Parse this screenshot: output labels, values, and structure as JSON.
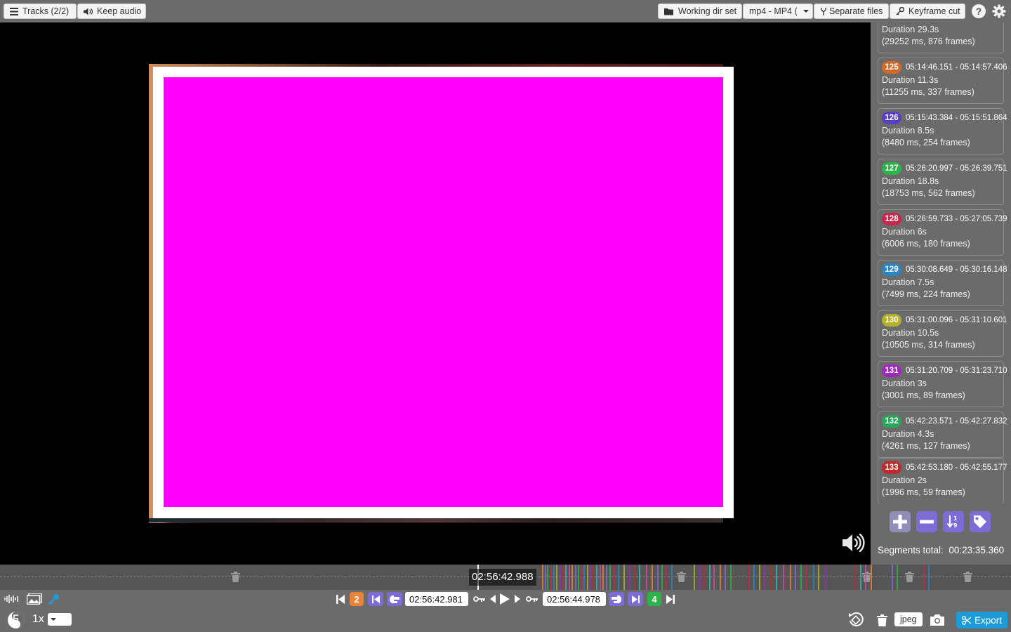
{
  "topbar": {
    "tracks_label": "Tracks (2/2)",
    "keep_audio_label": "Keep audio",
    "working_dir_label": "Working dir set",
    "format_label": "mp4 - MP4 (",
    "separate_files_label": "Separate files",
    "keyframe_cut_label": "Keyframe cut"
  },
  "segments": [
    {
      "num": "",
      "time": "",
      "duration": "Duration 29.3s",
      "detail": "(29252 ms, 876 frames)",
      "color": ""
    },
    {
      "num": "125",
      "time": "05:14:46.151 - 05:14:57.406",
      "duration": "Duration 11.3s",
      "detail": "(11255 ms, 337 frames)",
      "color": "#d06a2a"
    },
    {
      "num": "126",
      "time": "05:15:43.384 - 05:15:51.864",
      "duration": "Duration 8.5s",
      "detail": "(8480 ms, 254 frames)",
      "color": "#5a3fc0"
    },
    {
      "num": "127",
      "time": "05:26:20.997 - 05:26:39.751",
      "duration": "Duration 18.8s",
      "detail": "(18753 ms, 562 frames)",
      "color": "#2db34a"
    },
    {
      "num": "128",
      "time": "05:26:59.733 - 05:27:05.739",
      "duration": "Duration 6s",
      "detail": "(6006 ms, 180 frames)",
      "color": "#c9264b"
    },
    {
      "num": "129",
      "time": "05:30:08.649 - 05:30:16.148",
      "duration": "Duration 7.5s",
      "detail": "(7499 ms, 224 frames)",
      "color": "#2a86c0"
    },
    {
      "num": "130",
      "time": "05:31:00.096 - 05:31:10.601",
      "duration": "Duration 10.5s",
      "detail": "(10505 ms, 314 frames)",
      "color": "#b4b02a"
    },
    {
      "num": "131",
      "time": "05:31:20.709 - 05:31:23.710",
      "duration": "Duration 3s",
      "detail": "(3001 ms, 89 frames)",
      "color": "#9b2ab8"
    },
    {
      "num": "132",
      "time": "05:42:23.571 - 05:42:27.832",
      "duration": "Duration 4.3s",
      "detail": "(4261 ms, 127 frames)",
      "color": "#2aa65a"
    },
    {
      "num": "133",
      "time": "05:42:53.180 - 05:42:55.177",
      "duration": "Duration 2s",
      "detail": "(1996 ms, 59 frames)",
      "color": "#c02a2a"
    }
  ],
  "segments_total": {
    "label": "Segments total:",
    "value": "00:23:35.360"
  },
  "timeline": {
    "current_time": "02:56:42.988"
  },
  "controls": {
    "segment_start_num": "2",
    "start_time": "02:56:42.981",
    "end_time": "02:56:44.978",
    "segment_end_num": "4",
    "playback_rate": "1x",
    "capture_format": "jpeg",
    "export_label": "Export"
  },
  "colors": {
    "accent": "#1d9bd6",
    "cut_button": "#7d6bd6",
    "video_overlay": "#ff00ff"
  }
}
